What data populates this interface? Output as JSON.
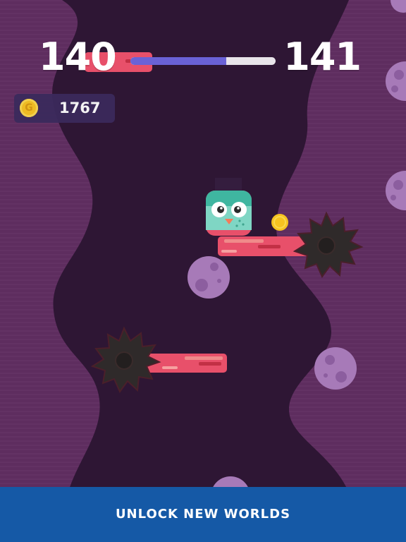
{
  "hud": {
    "level_current": "140",
    "level_next": "141",
    "progress": 0.66,
    "coin_count": "1767",
    "coin_icon": "coin-icon",
    "coin_symbol": "G"
  },
  "banner": {
    "text": "UNLOCK NEW WORLDS"
  },
  "colors": {
    "wall": "#5e2d5f",
    "shaft": "#2e1634",
    "platform": "#e8506a",
    "saw": "#2f2a2a",
    "planet": "#a77ab8",
    "progress_fill": "#6a62d6",
    "banner": "#1559a6",
    "player": "#3fb6a0"
  }
}
